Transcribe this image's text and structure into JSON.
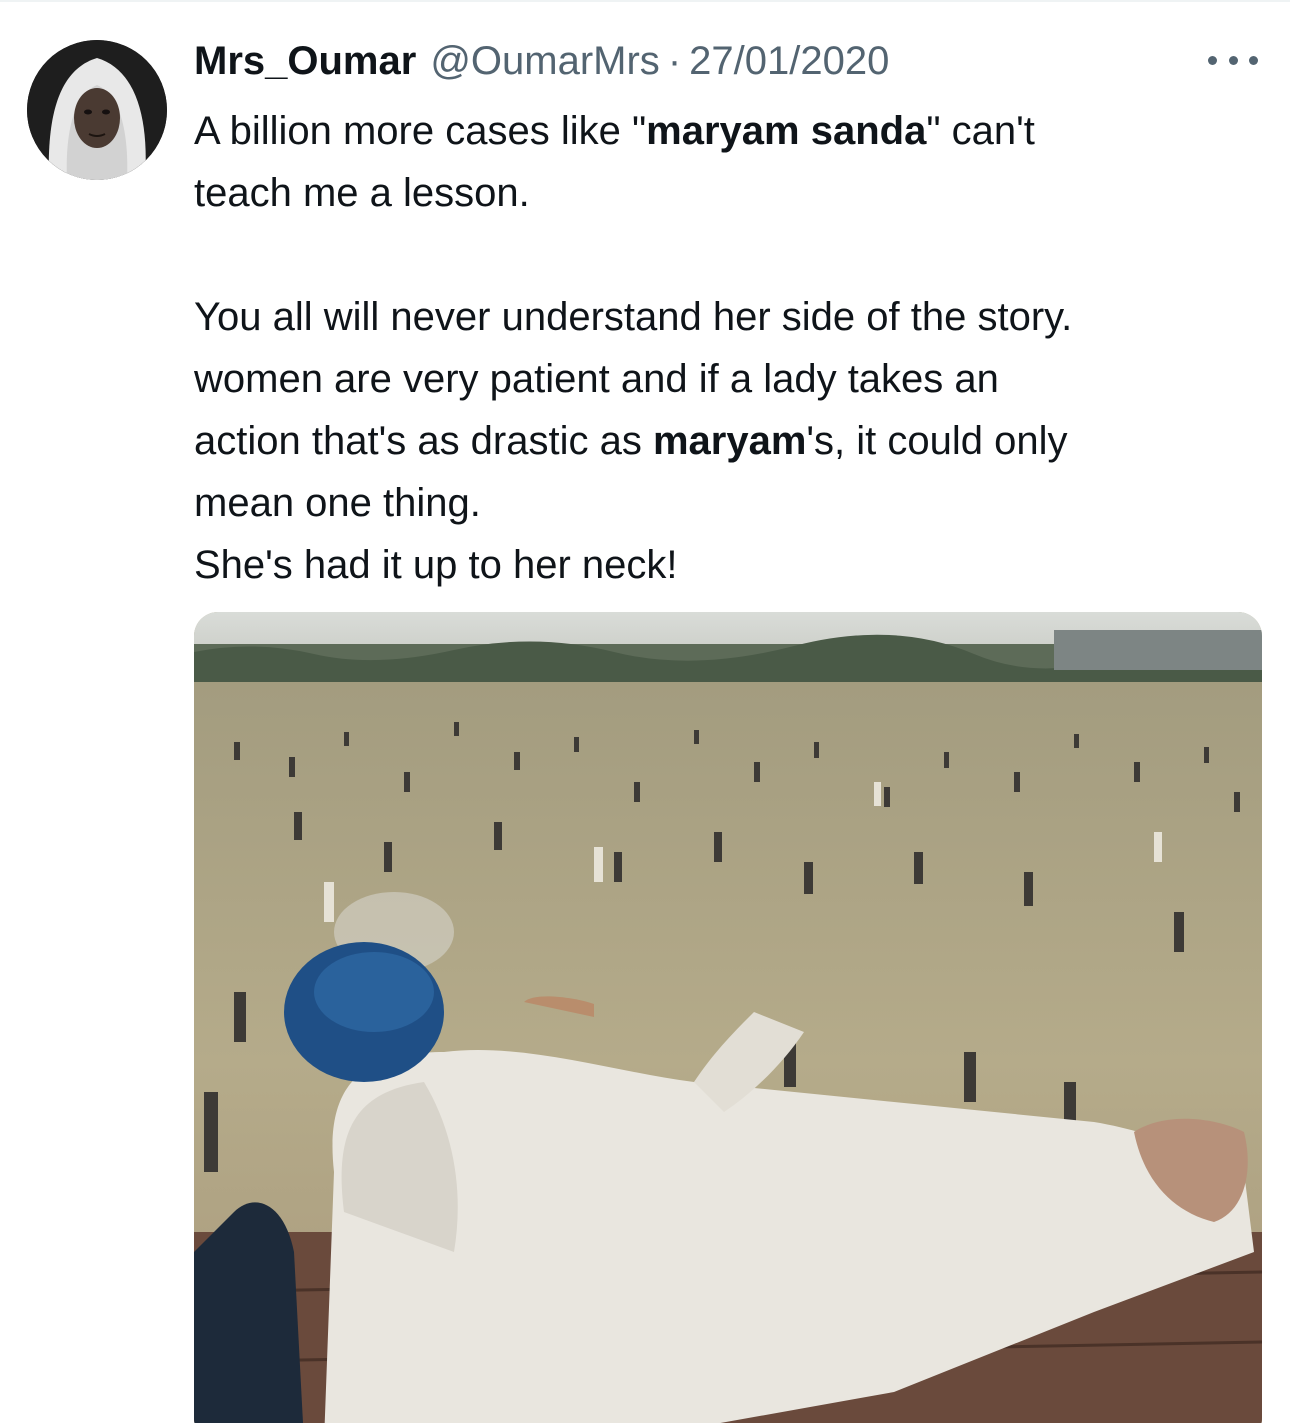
{
  "tweet": {
    "author": {
      "display_name": "Mrs_Oumar",
      "handle": "@OumarMrs"
    },
    "separator": "·",
    "date": "27/01/2020",
    "text": {
      "p1_before": "A billion more cases like \"",
      "p1_bold": "maryam sanda",
      "p1_after": "\" can't",
      "p2": "teach me a lesson.",
      "p3": "You all will never understand her side of the story.",
      "p4": "women are very patient and if a lady takes an",
      "p5_before": "action that's as drastic as ",
      "p5_bold": "maryam",
      "p5_after": "'s, it could only",
      "p6": "mean one thing.",
      "p7": "She's had it up to her neck!"
    }
  },
  "icons": {
    "more": "more-horizontal-icon"
  },
  "colors": {
    "text_primary": "#0f1419",
    "text_secondary": "#536471",
    "divider": "#eff3f4"
  }
}
